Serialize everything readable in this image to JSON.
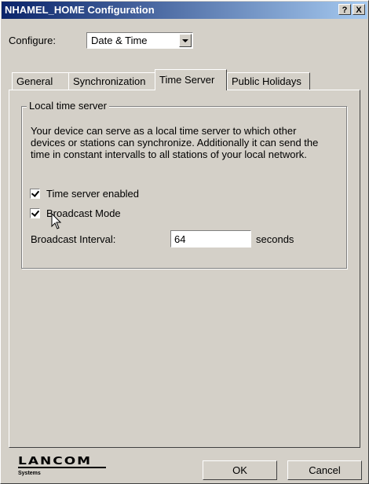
{
  "window": {
    "title": "NHAMEL_HOME Configuration",
    "help_label": "?",
    "close_label": "X",
    "titlebar_colors": [
      "#0a246a",
      "#a6caf0"
    ]
  },
  "configure": {
    "label": "Configure:",
    "value": "Date & Time"
  },
  "tabs": [
    {
      "label": "General",
      "active": false
    },
    {
      "label": "Synchronization",
      "active": false
    },
    {
      "label": "Time Server",
      "active": true
    },
    {
      "label": "Public Holidays",
      "active": false
    }
  ],
  "group": {
    "title": "Local time server",
    "description": "Your device can serve as a local time server to which other devices or stations can synchronize. Additionally it can send the time in constant intervalls to all stations of your local network.",
    "checkboxes": [
      {
        "label": "Time server enabled",
        "checked": true
      },
      {
        "label": "Broadcast Mode",
        "checked": true
      }
    ],
    "interval": {
      "label": "Broadcast Interval:",
      "value": "64",
      "unit": "seconds"
    }
  },
  "footer": {
    "logo": "LANCOM",
    "logo_sub": "Systems",
    "ok_label": "OK",
    "cancel_label": "Cancel"
  }
}
